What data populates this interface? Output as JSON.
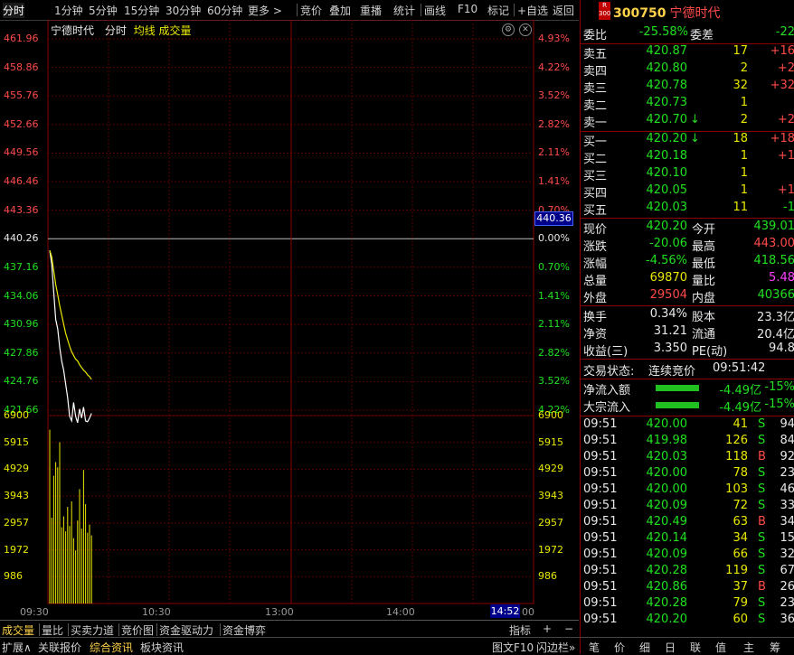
{
  "toolbar": {
    "items": [
      "分时",
      "1分钟",
      "5分钟",
      "15分钟",
      "30分钟",
      "60分钟",
      "更多 >",
      "竞价",
      "叠加",
      "重播",
      "统计",
      "画线",
      "F10",
      "标记",
      "+自选",
      "返回"
    ]
  },
  "stock": {
    "code": "300750",
    "name": "宁德时代",
    "badge_top": "R",
    "badge_bottom": "300"
  },
  "chart": {
    "title_name": "宁德时代",
    "title_mode": "分时",
    "title_avg": "均线",
    "title_vol": "成交量",
    "price_labels": [
      "461.96",
      "458.86",
      "455.76",
      "452.66",
      "449.56",
      "446.46",
      "443.36",
      "440.26",
      "437.16",
      "434.06",
      "430.96",
      "427.86",
      "424.76",
      "421.66"
    ],
    "pct_labels": [
      "4.93%",
      "4.22%",
      "3.52%",
      "2.82%",
      "2.11%",
      "1.41%",
      "0.70%",
      "0.00%",
      "0.70%",
      "1.41%",
      "2.11%",
      "2.82%",
      "3.52%",
      "4.22%"
    ],
    "vol_labels": [
      "6900",
      "5915",
      "4929",
      "3943",
      "2957",
      "1972",
      "986"
    ],
    "current_price_tag": "440.36",
    "x_labels": [
      "09:30",
      "10:30",
      "13:00",
      "14:00"
    ],
    "time_tag": "14:52",
    "x_end": "00"
  },
  "chart_data": {
    "type": "line",
    "title": "",
    "x": [
      "09:30",
      "09:31",
      "09:32",
      "09:33",
      "09:34",
      "09:35",
      "09:36",
      "09:37",
      "09:38",
      "09:39",
      "09:40",
      "09:41",
      "09:42",
      "09:43",
      "09:44",
      "09:45",
      "09:46",
      "09:47",
      "09:48",
      "09:49",
      "09:50",
      "09:51"
    ],
    "series": [
      {
        "name": "分时",
        "values": [
          439.0,
          437.5,
          434.5,
          431.5,
          430.5,
          428.5,
          427.0,
          426.0,
          424.5,
          423.0,
          421.0,
          420.5,
          422.5,
          421.0,
          420.3,
          421.8,
          420.8,
          422.0,
          420.5,
          420.4,
          420.8,
          421.3
        ]
      },
      {
        "name": "均线",
        "values": [
          439.0,
          438.3,
          436.8,
          435.3,
          434.2,
          433.0,
          432.0,
          431.0,
          430.0,
          429.3,
          428.6,
          428.0,
          427.6,
          427.2,
          427.0,
          426.6,
          426.3,
          426.0,
          425.8,
          425.5,
          425.3,
          425.0
        ]
      }
    ],
    "volume": [
      6380,
      3150,
      4690,
      5190,
      5000,
      5920,
      2800,
      3200,
      2650,
      3550,
      2850,
      3750,
      2400,
      1950,
      3050,
      4200,
      2750,
      4900,
      3650,
      2600,
      2900,
      2500
    ],
    "ylim": [
      418.56,
      461.96
    ],
    "vol_ylim": [
      0,
      6900
    ]
  },
  "panel": {
    "wb": {
      "label1": "委比",
      "val1": "-25.58%",
      "label2": "委差",
      "val2": "-22"
    },
    "asks": [
      {
        "label": "卖五",
        "price": "420.87",
        "vol": "17",
        "chg": "+16",
        "arrow": ""
      },
      {
        "label": "卖四",
        "price": "420.80",
        "vol": "2",
        "chg": "+2",
        "arrow": ""
      },
      {
        "label": "卖三",
        "price": "420.78",
        "vol": "32",
        "chg": "+32",
        "arrow": ""
      },
      {
        "label": "卖二",
        "price": "420.73",
        "vol": "1",
        "chg": "",
        "arrow": ""
      },
      {
        "label": "卖一",
        "price": "420.70",
        "vol": "2",
        "chg": "+2",
        "arrow": "↓"
      }
    ],
    "bids": [
      {
        "label": "买一",
        "price": "420.20",
        "vol": "18",
        "chg": "+18",
        "arrow": "↓"
      },
      {
        "label": "买二",
        "price": "420.18",
        "vol": "1",
        "chg": "+1",
        "arrow": ""
      },
      {
        "label": "买三",
        "price": "420.10",
        "vol": "1",
        "chg": "",
        "arrow": ""
      },
      {
        "label": "买四",
        "price": "420.05",
        "vol": "1",
        "chg": "+1",
        "arrow": ""
      },
      {
        "label": "买五",
        "price": "420.03",
        "vol": "11",
        "chg": "-1",
        "arrow": ""
      }
    ],
    "quote": [
      {
        "l1": "现价",
        "v1": "420.20",
        "c1": "green",
        "l2": "今开",
        "v2": "439.01",
        "c2": "green"
      },
      {
        "l1": "涨跌",
        "v1": "-20.06",
        "c1": "green",
        "l2": "最高",
        "v2": "443.00",
        "c2": "red"
      },
      {
        "l1": "涨幅",
        "v1": "-4.56%",
        "c1": "green",
        "l2": "最低",
        "v2": "418.56",
        "c2": "green"
      },
      {
        "l1": "总量",
        "v1": "69870",
        "c1": "yellow",
        "l2": "量比",
        "v2": "5.48",
        "c2": "magenta"
      },
      {
        "l1": "外盘",
        "v1": "29504",
        "c1": "red",
        "l2": "内盘",
        "v2": "40366",
        "c2": "green"
      }
    ],
    "fund": [
      {
        "l1": "换手",
        "v1": "0.34%",
        "l2": "股本",
        "v2": "23.3亿"
      },
      {
        "l1": "净资",
        "v1": "31.21",
        "l2": "流通",
        "v2": "20.4亿"
      },
      {
        "l1": "收益(三)",
        "v1": "3.350",
        "l2": "PE(动)",
        "v2": "94.8"
      }
    ],
    "status": {
      "label": "交易状态:",
      "value": "连续竞价",
      "time": "09:51:42"
    },
    "flows": [
      {
        "label": "净流入额",
        "value": "-4.49亿",
        "pct": "-15%"
      },
      {
        "label": "大宗流入",
        "value": "-4.49亿",
        "pct": "-15%"
      }
    ],
    "ticks": [
      {
        "t": "09:51",
        "p": "420.00",
        "v": "41",
        "s": "S",
        "n": "94"
      },
      {
        "t": "09:51",
        "p": "419.98",
        "v": "126",
        "s": "S",
        "n": "84"
      },
      {
        "t": "09:51",
        "p": "420.03",
        "v": "118",
        "s": "B",
        "n": "92"
      },
      {
        "t": "09:51",
        "p": "420.00",
        "v": "78",
        "s": "S",
        "n": "23"
      },
      {
        "t": "09:51",
        "p": "420.00",
        "v": "103",
        "s": "S",
        "n": "46"
      },
      {
        "t": "09:51",
        "p": "420.09",
        "v": "72",
        "s": "S",
        "n": "33"
      },
      {
        "t": "09:51",
        "p": "420.49",
        "v": "63",
        "s": "B",
        "n": "34"
      },
      {
        "t": "09:51",
        "p": "420.14",
        "v": "34",
        "s": "S",
        "n": "15"
      },
      {
        "t": "09:51",
        "p": "420.09",
        "v": "66",
        "s": "S",
        "n": "32"
      },
      {
        "t": "09:51",
        "p": "420.28",
        "v": "119",
        "s": "S",
        "n": "67"
      },
      {
        "t": "09:51",
        "p": "420.86",
        "v": "37",
        "s": "B",
        "n": "26"
      },
      {
        "t": "09:51",
        "p": "420.28",
        "v": "79",
        "s": "S",
        "n": "23"
      },
      {
        "t": "09:51",
        "p": "420.20",
        "v": "60",
        "s": "S",
        "n": "36"
      }
    ]
  },
  "bottom": {
    "tabs1": [
      "成交量",
      "量比",
      "买卖力道",
      "竞价图",
      "资金驱动力",
      "资金博弈"
    ],
    "right1": [
      "指标",
      "+",
      "−"
    ],
    "tabs2": [
      "扩展∧",
      "关联报价",
      "综合资讯",
      "板块资讯"
    ],
    "right2": [
      "图文F10",
      "闪边栏»",
      "笔",
      "价",
      "细",
      "日",
      "联",
      "值",
      "主",
      "筹"
    ]
  },
  "colors": {
    "up": "#ff4a4a",
    "down": "#20e020",
    "avg": "#e8e800",
    "vol": "#e8e800",
    "frame": "#8a0000"
  }
}
